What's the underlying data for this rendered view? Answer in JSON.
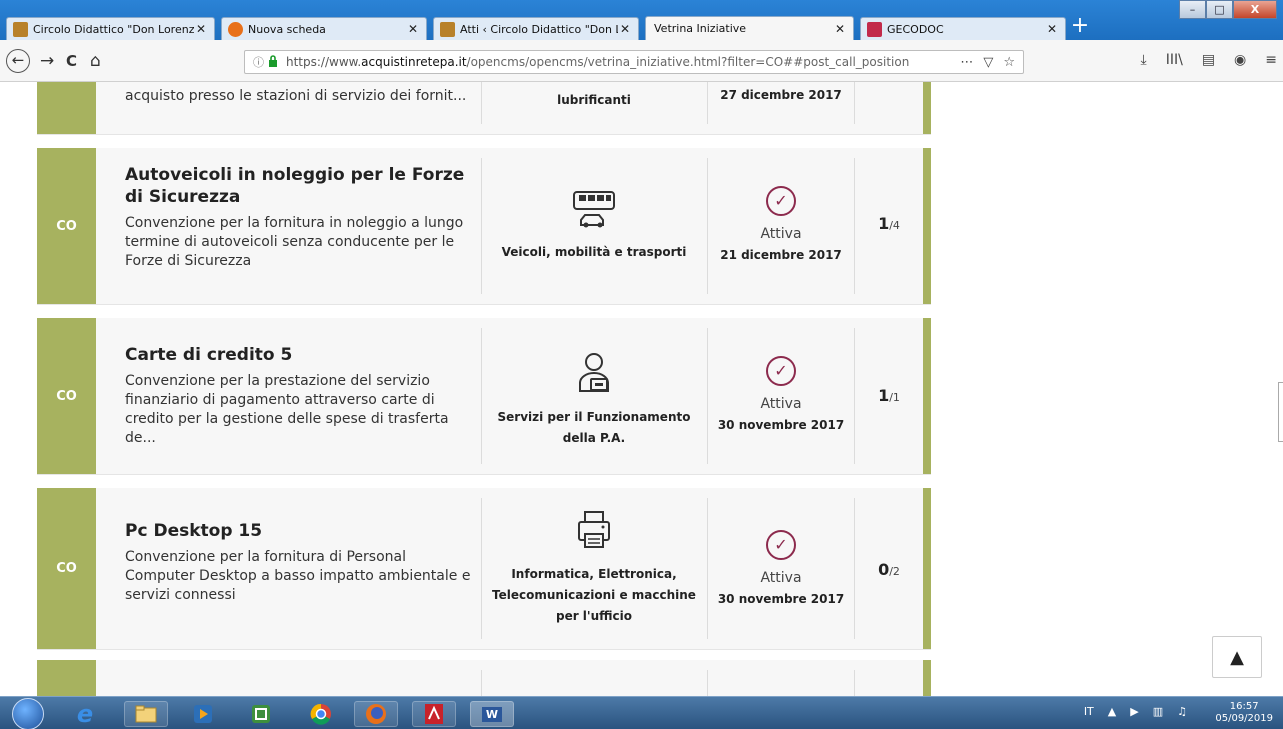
{
  "tabs": [
    {
      "label": "Circolo Didattico \"Don Lorenzo",
      "favicon_color": "#b8812a",
      "active": false
    },
    {
      "label": "Nuova scheda",
      "favicon_color": "#e8701a",
      "active": false
    },
    {
      "label": "Atti ‹ Circolo Didattico \"Don Lo",
      "favicon_color": "#b8812a",
      "active": false
    },
    {
      "label": "Vetrina Iniziative",
      "favicon_color": "",
      "active": true
    },
    {
      "label": "GECODOC",
      "favicon_color": "#c22a4b",
      "active": false
    }
  ],
  "tab_close_glyph": "✕",
  "newtab_glyph": "+",
  "window_buttons": {
    "minimize": "–",
    "maximize": "□",
    "close": "X"
  },
  "nav": {
    "back": "←",
    "forward": "→",
    "reload": "C",
    "home": "⌂"
  },
  "url": {
    "info": "ⓘ",
    "lock": "🔒",
    "prefix": "https://www.",
    "host": "acquistinretepa.it",
    "rest": "/opencms/opencms/vetrina_iniziative.html?filter=CO##post_call_position"
  },
  "url_icons": [
    "⋯",
    "▽",
    "☆"
  ],
  "toolbar_icons": [
    "⤓",
    "III\\",
    "▤",
    "◉",
    "≡"
  ],
  "partial_top_card": {
    "desc": "acquisto presso le stazioni di servizio dei fornit...",
    "category": "lubrificanti",
    "date": "27 dicembre 2017"
  },
  "cards": [
    {
      "badge": "CO",
      "title": "Autoveicoli in noleggio per le Forze di Sicurezza",
      "desc": "Convenzione per la fornitura in noleggio a lungo termine di autoveicoli senza conducente per le Forze di Sicurezza",
      "category_icon": "vehicles-icon",
      "category": "Veicoli, mobilità e trasporti",
      "status": "Attiva",
      "date": "21 dicembre 2017",
      "count": "1",
      "total": "/4"
    },
    {
      "badge": "CO",
      "title": "Carte di credito 5",
      "desc": "Convenzione per la prestazione del servizio finanziario di pagamento attraverso carte di credito per la gestione delle spese di trasferta de...",
      "category_icon": "pa-services-icon",
      "category": "Servizi per il Funzionamento della P.A.",
      "status": "Attiva",
      "date": "30 novembre 2017",
      "count": "1",
      "total": "/1"
    },
    {
      "badge": "CO",
      "title": "Pc Desktop 15",
      "desc": "Convenzione per la fornitura di Personal Computer Desktop a basso impatto ambientale e servizi connessi",
      "category_icon": "printer-icon",
      "category": "Informatica, Elettronica, Telecomunicazioni e macchine per l'ufficio",
      "status": "Attiva",
      "date": "30 novembre 2017",
      "count": "0",
      "total": "/2"
    }
  ],
  "check_glyph": "✓",
  "scroll_top_glyph": "▲",
  "colors": {
    "badge_green": "#a7b25f",
    "status_accent": "#8c2a4d"
  },
  "taskbar": {
    "apps": [
      "internet-explorer",
      "file-explorer",
      "media-player",
      "camtasia",
      "chrome",
      "firefox",
      "acrobat",
      "word"
    ],
    "word_label": "W",
    "lang": "IT",
    "tray_glyphs": [
      "▲",
      "▶",
      "▥",
      "♫"
    ],
    "time": "16:57",
    "date": "05/09/2019"
  }
}
